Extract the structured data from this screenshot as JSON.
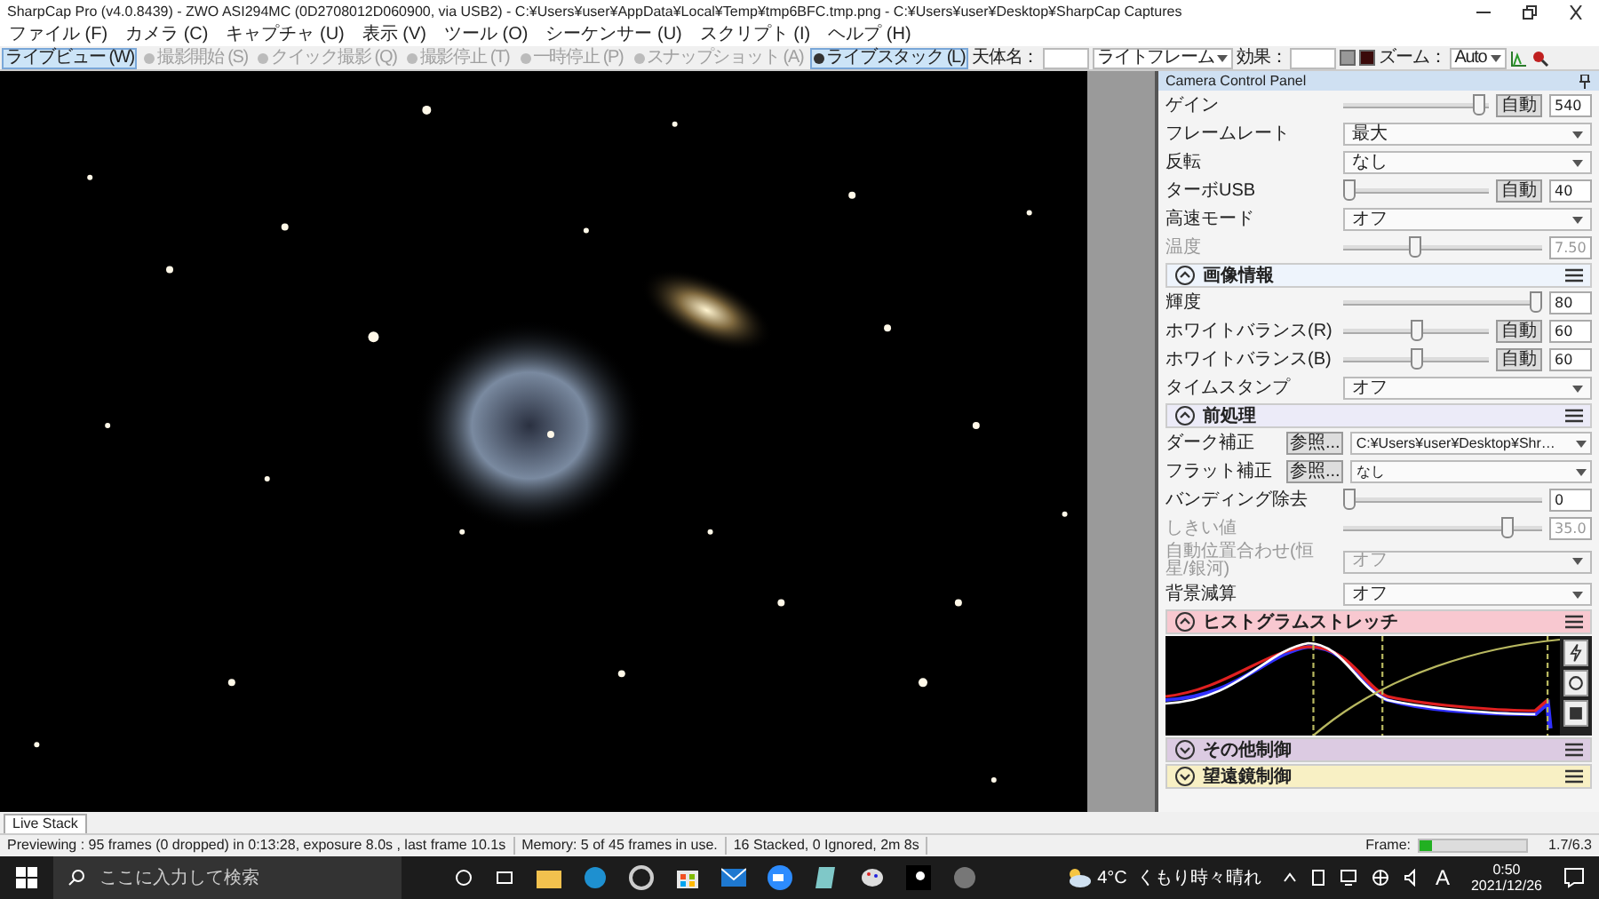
{
  "window": {
    "title": "SharpCap Pro (v4.0.8439) - ZWO ASI294MC (0D2708012D060900, via USB2) - C:¥Users¥user¥AppData¥Local¥Temp¥tmp6BFC.tmp.png - C:¥Users¥user¥Desktop¥SharpCap Captures"
  },
  "menu": [
    "ファイル (F)",
    "カメラ (C)",
    "キャプチャ (U)",
    "表示 (V)",
    "ツール (O)",
    "シーケンサー (U)",
    "スクリプト (I)",
    "ヘルプ (H)"
  ],
  "toolbar": [
    {
      "kind": "button",
      "label": "ライブビュー (W)",
      "selected": true,
      "disabled": false
    },
    {
      "kind": "button",
      "label": "撮影開始 (S)",
      "selected": false,
      "disabled": true
    },
    {
      "kind": "button",
      "label": "クイック撮影 (Q)",
      "selected": false,
      "disabled": true
    },
    {
      "kind": "button",
      "label": "撮影停止 (T)",
      "selected": false,
      "disabled": true
    },
    {
      "kind": "button",
      "label": "一時停止 (P)",
      "selected": false,
      "disabled": true
    },
    {
      "kind": "button",
      "label": "スナップショット (A)",
      "selected": false,
      "disabled": true
    },
    {
      "kind": "button",
      "label": "ライブスタック (L)",
      "selected": true,
      "disabled": false
    },
    {
      "kind": "label",
      "label": "天体名："
    },
    {
      "kind": "field"
    },
    {
      "kind": "dropdown",
      "label": "ライトフレーム"
    },
    {
      "kind": "label",
      "label": "効果："
    },
    {
      "kind": "field"
    },
    {
      "kind": "swatch"
    },
    {
      "kind": "label",
      "label": "ズーム："
    },
    {
      "kind": "dropdown",
      "label": "Auto"
    }
  ],
  "panel": {
    "title": "Camera Control Panel",
    "sections": [
      {
        "kind": "controls",
        "rows": [
          {
            "kind": "slider",
            "label": "ゲイン",
            "level": 0.97,
            "auto": "自動",
            "value": "540",
            "disabled": false
          },
          {
            "kind": "select",
            "label": "フレームレート",
            "value": "最大",
            "disabled": false
          },
          {
            "kind": "select",
            "label": "反転",
            "value": "なし",
            "disabled": false
          },
          {
            "kind": "slider",
            "label": "ターボUSB",
            "level": 0,
            "auto": "自動",
            "value": "40",
            "disabled": false
          },
          {
            "kind": "select",
            "label": "高速モード",
            "value": "オフ",
            "disabled": false
          },
          {
            "kind": "slider",
            "label": "温度",
            "level": 0.35,
            "value": "7.50",
            "disabled": true
          }
        ]
      },
      {
        "title": "画像情報",
        "kind": "controls",
        "expanded": true,
        "color": "#eef4fc",
        "rows": [
          {
            "kind": "slider",
            "label": "輝度",
            "level": 1,
            "value": "80",
            "disabled": false
          },
          {
            "kind": "slider",
            "label": "ホワイトバランス(R)",
            "level": 0.5,
            "auto": "自動",
            "value": "60",
            "disabled": false
          },
          {
            "kind": "slider",
            "label": "ホワイトバランス(B)",
            "level": 0.5,
            "auto": "自動",
            "value": "60",
            "disabled": false
          },
          {
            "kind": "select",
            "label": "タイムスタンプ",
            "value": "オフ",
            "disabled": false
          }
        ]
      },
      {
        "title": "前処理",
        "kind": "controls",
        "expanded": true,
        "color": "#ecebf8",
        "rows": [
          {
            "kind": "file",
            "label": "ダーク補正",
            "button": "参照...",
            "value": "C:¥Users¥user¥Desktop¥Shr…",
            "disabled": false
          },
          {
            "kind": "file",
            "label": "フラット補正",
            "button": "参照...",
            "value": "なし",
            "disabled": false
          },
          {
            "kind": "slider",
            "label": "バンディング除去",
            "level": 0,
            "value": "0",
            "disabled": false
          },
          {
            "kind": "slider",
            "label": "しきい値",
            "level": 0.85,
            "value": "35.0",
            "disabled": true
          },
          {
            "kind": "select",
            "label": "自動位置合わせ(恒星/銀河)",
            "value": "オフ",
            "disabled": true
          },
          {
            "kind": "select",
            "label": "背景減算",
            "value": "オフ",
            "disabled": false
          }
        ]
      },
      {
        "title": "ヒストグラムストレッチ",
        "kind": "histogram",
        "expanded": true,
        "color": "#f8c8d0"
      },
      {
        "title": "その他制御",
        "expanded": false,
        "color": "#dccbe2"
      },
      {
        "title": "望遠鏡制御",
        "expanded": false,
        "color": "#f8f0c4"
      }
    ]
  },
  "document_tab": {
    "label": "Live Stack",
    "selected": true
  },
  "status_bar": {
    "segments": [
      "Previewing : 95 frames (0 dropped) in 0:13:28, exposure 8.0s , last frame 10.1s",
      "Memory: 5 of 45 frames in use.",
      "16 Stacked, 0 Ignored, 2m 8s"
    ],
    "frame_label": "Frame:",
    "level": 0.12,
    "frame_value": "1.7/6.3"
  },
  "taskbar": {
    "search_placeholder": "ここに入力して検索",
    "weather": "4°C  くもり時々晴れ",
    "ime": "A",
    "time": "0:50",
    "date": "2021/12/26"
  }
}
